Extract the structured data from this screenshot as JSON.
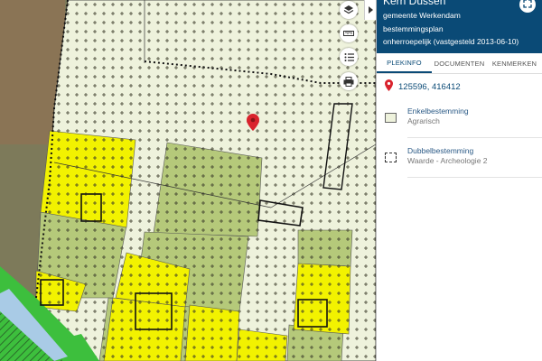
{
  "panel": {
    "location_name": "Kern Dussen",
    "municipality": "gemeente Werkendam",
    "plan_type": "bestemmingsplan",
    "plan_status": "onherroepelijk (vastgesteld 2013-06-10)",
    "tabs": [
      {
        "label": "PLEKINFO",
        "active": true
      },
      {
        "label": "DOCUMENTEN",
        "active": false
      },
      {
        "label": "KENMERKEN",
        "active": false
      }
    ],
    "coordinates": "125596, 416412",
    "entries": [
      {
        "title": "Enkelbestemming",
        "value": "Agrarisch",
        "swatch": "agrarisch"
      },
      {
        "title": "Dubbelbestemming",
        "value": "Waarde - Archeologie 2",
        "swatch": "archeologie"
      }
    ]
  },
  "map_controls": [
    {
      "name": "layers-button",
      "icon": "layers-icon"
    },
    {
      "name": "measure-button",
      "icon": "ruler-icon"
    },
    {
      "name": "legend-button",
      "icon": "list-icon"
    },
    {
      "name": "print-button",
      "icon": "printer-icon"
    }
  ],
  "colors": {
    "header_bg": "#0a4a76",
    "agrarisch": "#eef2dc",
    "agrarisch_dark": "#b5c97a",
    "yellow_zone": "#f2f200",
    "green_zone": "#3dbf3d",
    "water": "#a9cbe6",
    "pin": "#d9232d"
  }
}
